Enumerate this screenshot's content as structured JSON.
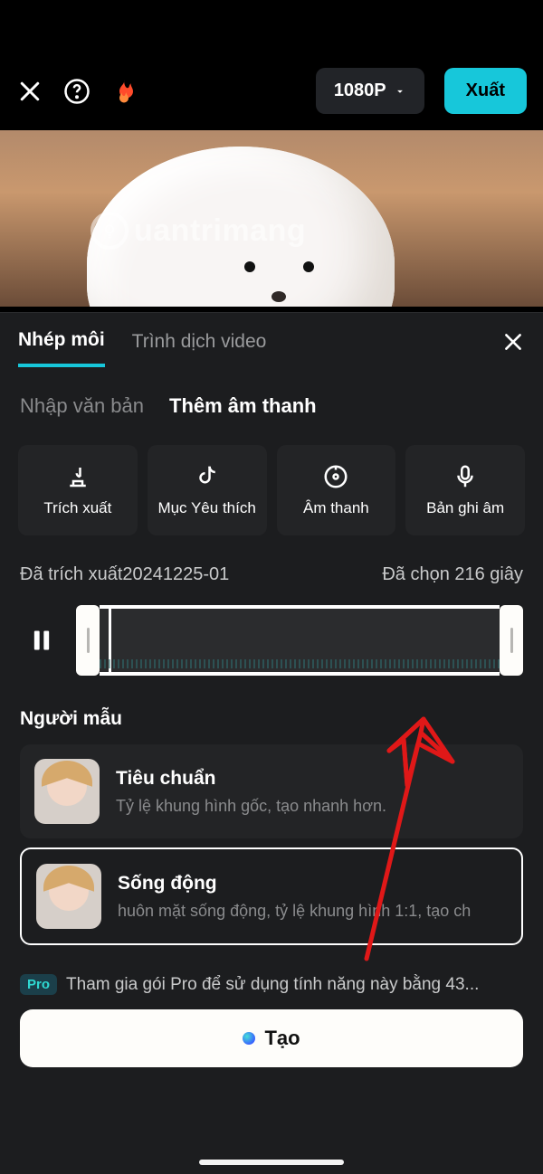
{
  "topbar": {
    "resolution": "1080P",
    "export_label": "Xuất"
  },
  "preview": {
    "watermark_text": "uantrimang"
  },
  "sheet": {
    "tabs": {
      "lip_sync": "Nhép môi",
      "video_translate": "Trình dịch video"
    },
    "subtabs": {
      "enter_text": "Nhập văn bản",
      "add_audio": "Thêm âm thanh"
    },
    "audio_options": {
      "extract": "Trích xuất",
      "favorite": "Mục Yêu thích",
      "audio": "Âm thanh",
      "record": "Bản ghi âm"
    },
    "extracted_name": "Đã trích xuất20241225-01",
    "selected_duration": "Đã chọn 216 giây",
    "model_label": "Người mẫu",
    "models": {
      "standard": {
        "title": "Tiêu chuẩn",
        "sub": "Tỷ lệ khung hình gốc, tạo nhanh hơn."
      },
      "dynamic": {
        "title": "Sống động",
        "sub": "huôn mặt sống động, tỷ lệ khung hình 1:1, tạo ch"
      }
    },
    "pro_badge": "Pro",
    "pro_text": "Tham gia gói Pro để sử dụng tính năng này bằng 43...",
    "create_label": "Tạo"
  }
}
